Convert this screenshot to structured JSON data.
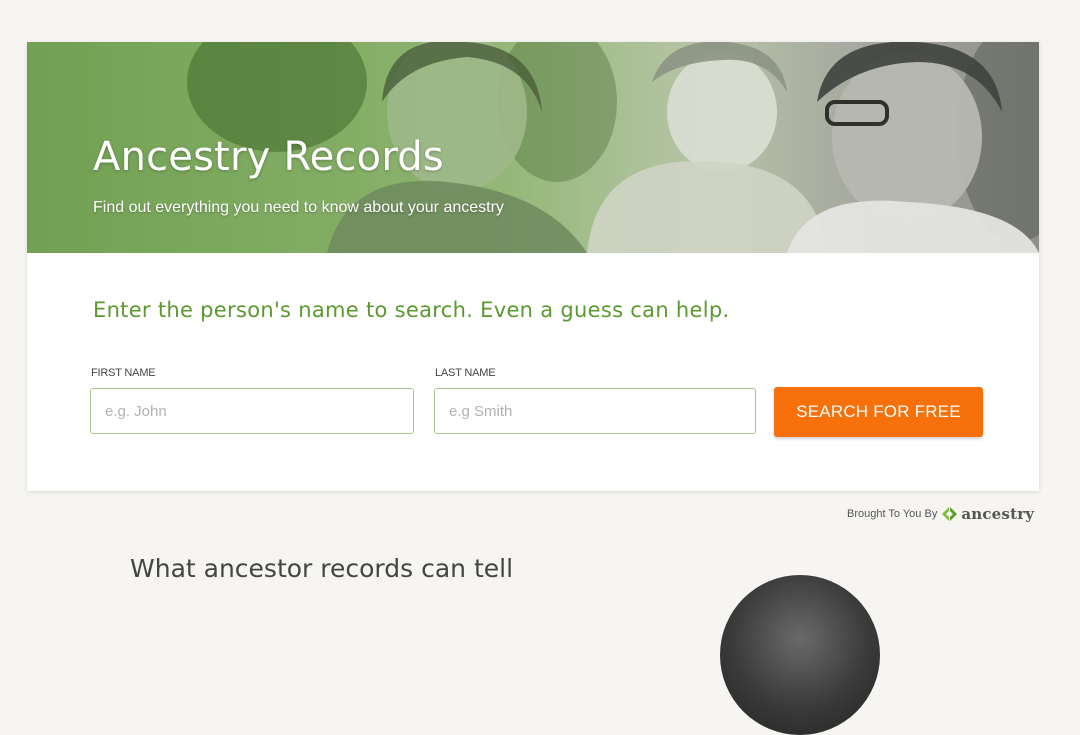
{
  "hero": {
    "title": "Ancestry Records",
    "subtitle": "Find out everything you need to know about your ancestry"
  },
  "search": {
    "prompt": "Enter the person's name to search. Even a guess can help.",
    "first_name_label": "FIRST NAME",
    "first_name_placeholder": "e.g. John",
    "first_name_value": "",
    "last_name_label": "LAST NAME",
    "last_name_placeholder": "e.g Smith",
    "last_name_value": "",
    "button_label": "SEARCH FOR FREE"
  },
  "attribution": {
    "text": "Brought To You By",
    "brand": "ancestry"
  },
  "section": {
    "heading": "What ancestor records can tell"
  },
  "colors": {
    "accent_green": "#5a9a2f",
    "button_orange": "#f8700a",
    "field_border": "#a8c78b"
  },
  "icons": {
    "brand_logo": "ancestry-leaf-logo-icon"
  }
}
